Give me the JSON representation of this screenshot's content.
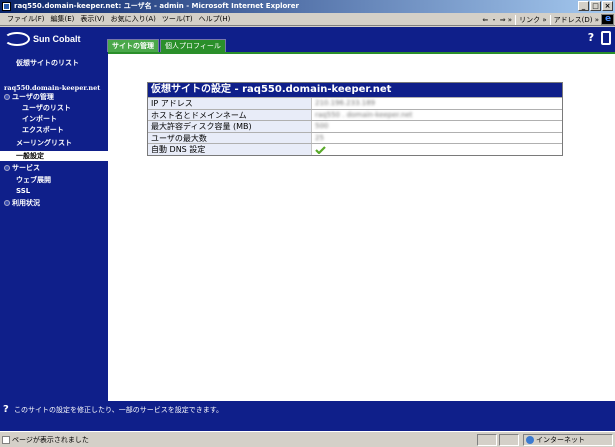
{
  "window": {
    "title": "raq550.domain-keeper.net: ユーザ名 - admin - Microsoft Internet Explorer",
    "buttons": [
      "_",
      "□",
      "×"
    ]
  },
  "menubar": {
    "items": [
      "ファイル(F)",
      "編集(E)",
      "表示(V)",
      "お気に入り(A)",
      "ツール(T)",
      "ヘルプ(H)"
    ],
    "nav_back": "⇐ ・ ⇒ »",
    "links": "リンク »",
    "address": "アドレス(D) »"
  },
  "header": {
    "brand": "Sun Cobalt",
    "tabs": [
      {
        "label": "サイトの管理",
        "active": true
      },
      {
        "label": "個人プロフィール",
        "active": false
      }
    ],
    "help_icon": "?",
    "logout_icon": "door-icon"
  },
  "sidebar": {
    "virtual_site_list": "仮想サイトのリスト",
    "site_name": "raq550.domain-keeper.net",
    "items": [
      {
        "label": "ユーザの管理",
        "level": 0,
        "expandable": true
      },
      {
        "label": "ユーザのリスト",
        "level": 1
      },
      {
        "label": "インポート",
        "level": 1
      },
      {
        "label": "エクスポート",
        "level": 1
      },
      {
        "label": "メーリングリスト",
        "level": 0
      },
      {
        "label": "一般設定",
        "level": 0,
        "selected": true
      },
      {
        "label": "サービス",
        "level": 0,
        "expandable": true
      },
      {
        "label": "ウェブ展開",
        "level": 0
      },
      {
        "label": "SSL",
        "level": 0
      },
      {
        "label": "利用状況",
        "level": 0,
        "expandable": true
      }
    ]
  },
  "settings": {
    "title": "仮想サイトの設定 - raq550.domain-keeper.net",
    "rows": [
      {
        "label": "IP アドレス",
        "value": "210.196.233.189"
      },
      {
        "label": "ホスト名とドメインネーム",
        "value": "raq550 . domain-keeper.net"
      },
      {
        "label": "最大許容ディスク容量 (MB)",
        "value": "500"
      },
      {
        "label": "ユーザの最大数",
        "value": "25"
      },
      {
        "label": "自動 DNS 設定",
        "value": ""
      }
    ]
  },
  "helpbar": {
    "text": "このサイトの設定を修正したり、一部のサービスを設定できます。"
  },
  "statusbar": {
    "text": "ページが表示されました",
    "zone": "インターネット"
  },
  "colors": {
    "cobalt_blue": "#0f1f8a",
    "tab_green": "#4aa84a",
    "check_green": "#5aaa2a"
  }
}
